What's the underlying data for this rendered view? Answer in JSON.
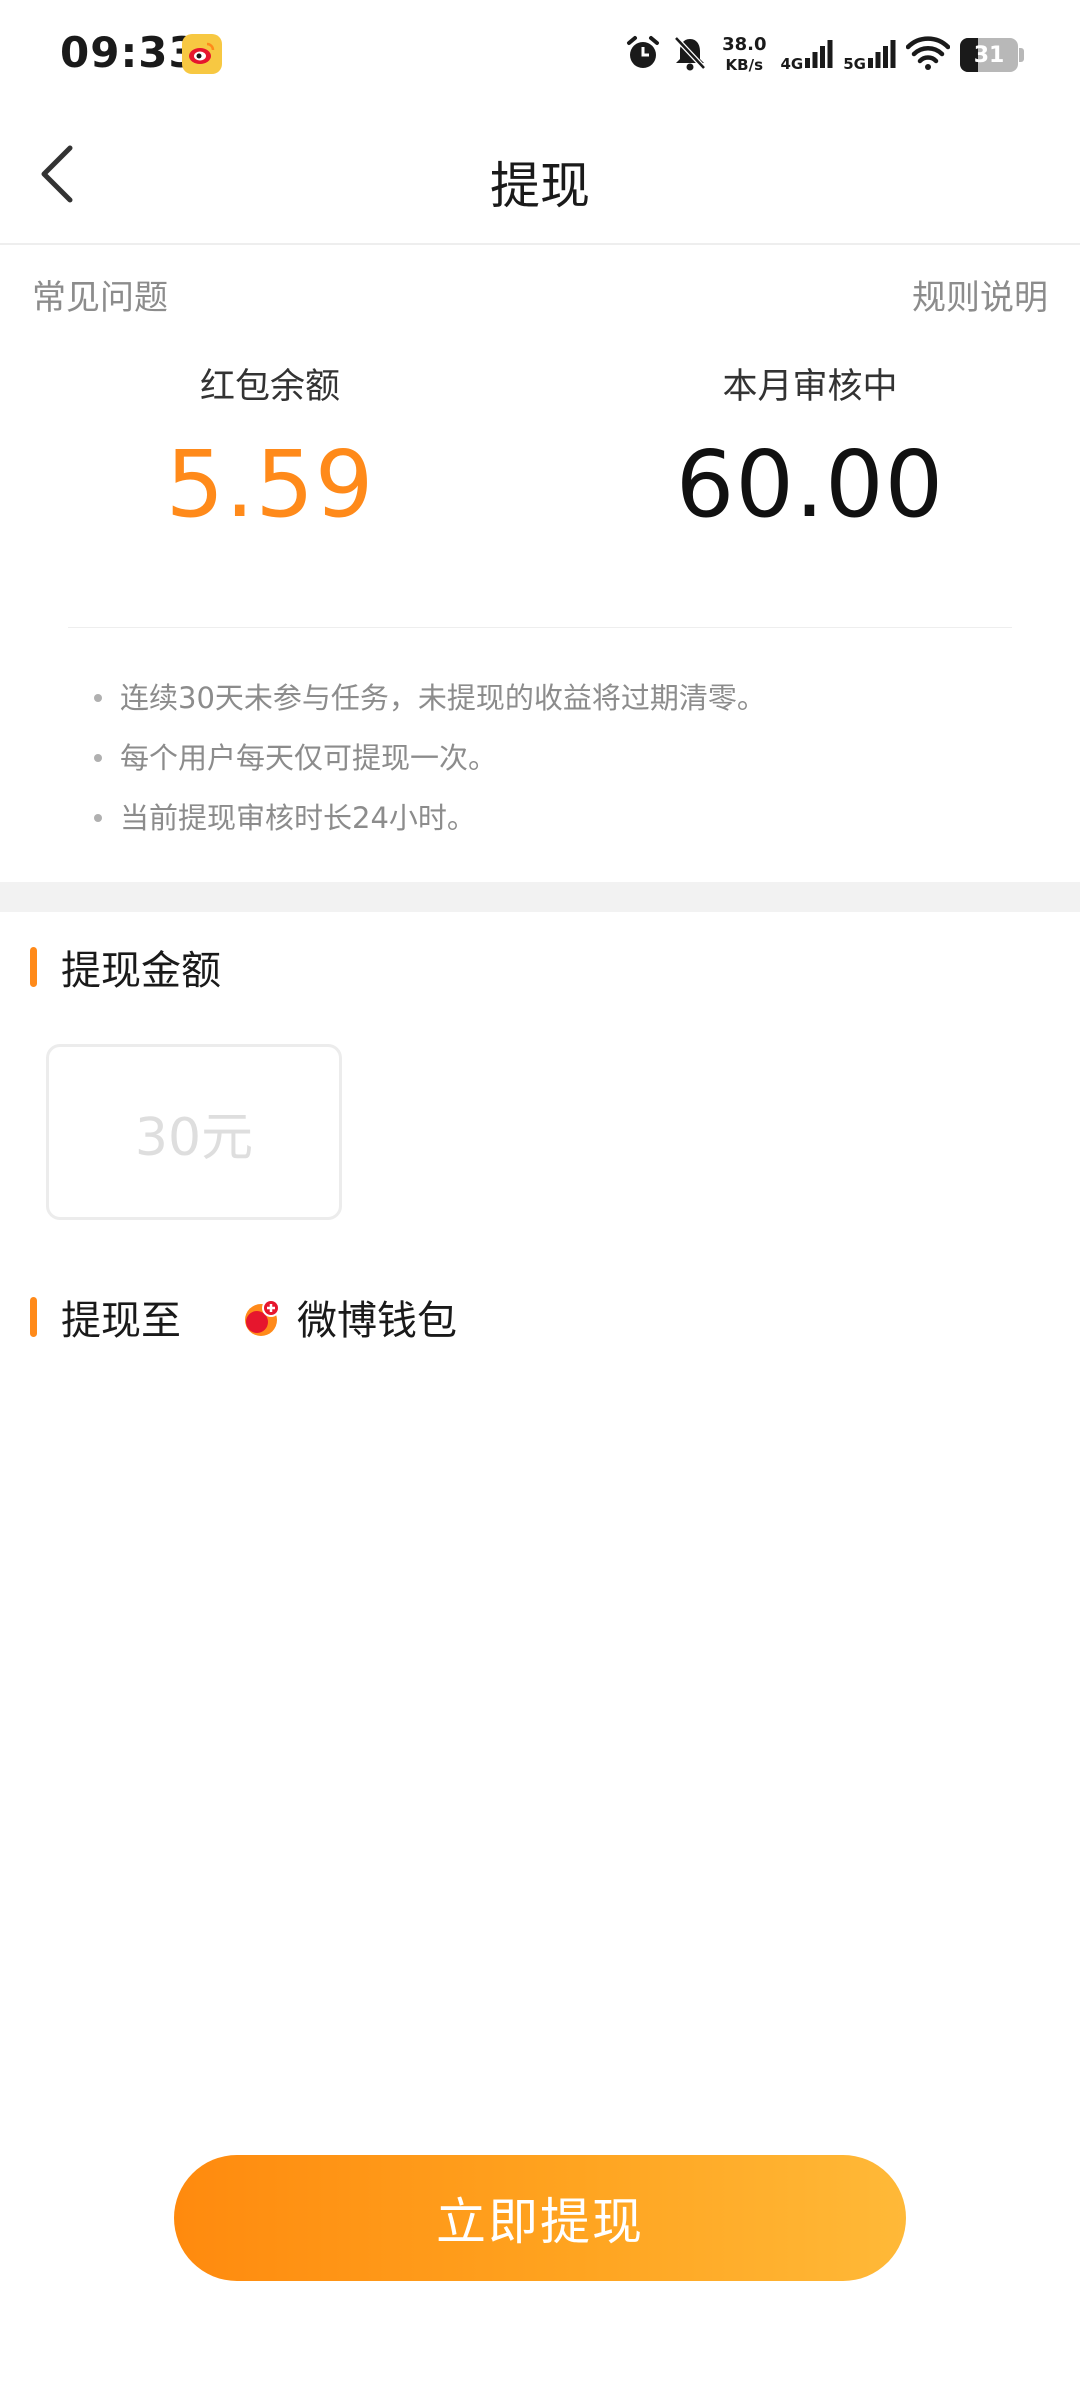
{
  "status_bar": {
    "time": "09:33",
    "net_speed_value": "38.0",
    "net_speed_unit": "KB/s",
    "net_4g": "4G",
    "net_5g": "5G",
    "battery": "31",
    "battery_level": 0.31
  },
  "nav": {
    "title": "提现"
  },
  "links": {
    "faq": "常见问题",
    "rules": "规则说明"
  },
  "balance": {
    "red_packet_label": "红包余额",
    "red_packet_value": "5.59",
    "review_label": "本月审核中",
    "review_value": "60.00"
  },
  "notes": [
    "连续30天未参与任务，未提现的收益将过期清零。",
    "每个用户每天仅可提现一次。",
    "当前提现审核时长24小时。"
  ],
  "amount_section": {
    "title": "提现金额",
    "options": [
      "30元"
    ]
  },
  "destination_section": {
    "title": "提现至",
    "wallet_label": "微博钱包"
  },
  "submit": {
    "label": "立即提现"
  },
  "colors": {
    "accent": "#ff8a1a",
    "muted_text": "#8c8c8c"
  }
}
